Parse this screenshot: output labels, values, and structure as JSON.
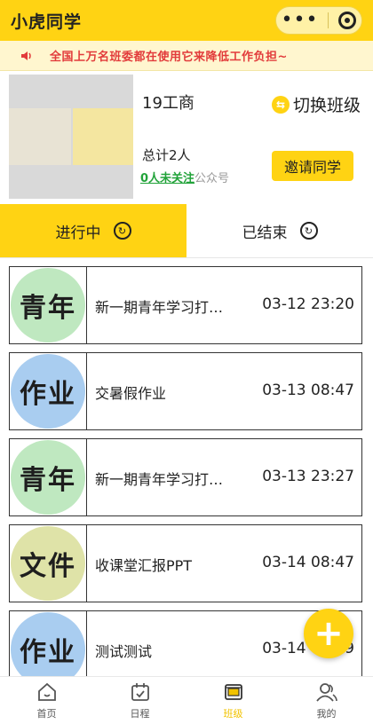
{
  "app": {
    "title": "小虎同学"
  },
  "colors": {
    "brand": "#ffd313",
    "notice_text": "#e23b3b",
    "follow_link": "#22a33a"
  },
  "notice": {
    "icon": "speaker-icon",
    "text": "全国上万名班委都在使用它来降低工作负担~"
  },
  "class_card": {
    "name": "19工商",
    "switch_label": "切换班级",
    "count": "总计2人",
    "follow_link": "0人未关注",
    "follow_suffix": "公众号",
    "invite_label": "邀请同学"
  },
  "tabs": [
    {
      "label": "进行中",
      "active": true
    },
    {
      "label": "已结束",
      "active": false
    }
  ],
  "tasks": [
    {
      "badge": "青年",
      "badge_color": "#bfe8c0",
      "title": "新一期青年学习打…",
      "time": "03-12 23:20"
    },
    {
      "badge": "作业",
      "badge_color": "#a9cdf0",
      "title": "交暑假作业",
      "time": "03-13 08:47"
    },
    {
      "badge": "青年",
      "badge_color": "#bfe8c0",
      "title": "新一期青年学习打…",
      "time": "03-13 23:27"
    },
    {
      "badge": "文件",
      "badge_color": "#dfe3a8",
      "title": "收课堂汇报PPT",
      "time": "03-14 08:47"
    },
    {
      "badge": "作业",
      "badge_color": "#a9cdf0",
      "title": "测试测试",
      "time": "03-14 08:49"
    }
  ],
  "fab": {
    "label": "+"
  },
  "bottom_nav": [
    {
      "label": "首页",
      "icon": "home-icon",
      "active": false
    },
    {
      "label": "日程",
      "icon": "calendar-icon",
      "active": false
    },
    {
      "label": "班级",
      "icon": "class-icon",
      "active": true
    },
    {
      "label": "我的",
      "icon": "user-icon",
      "active": false
    }
  ]
}
